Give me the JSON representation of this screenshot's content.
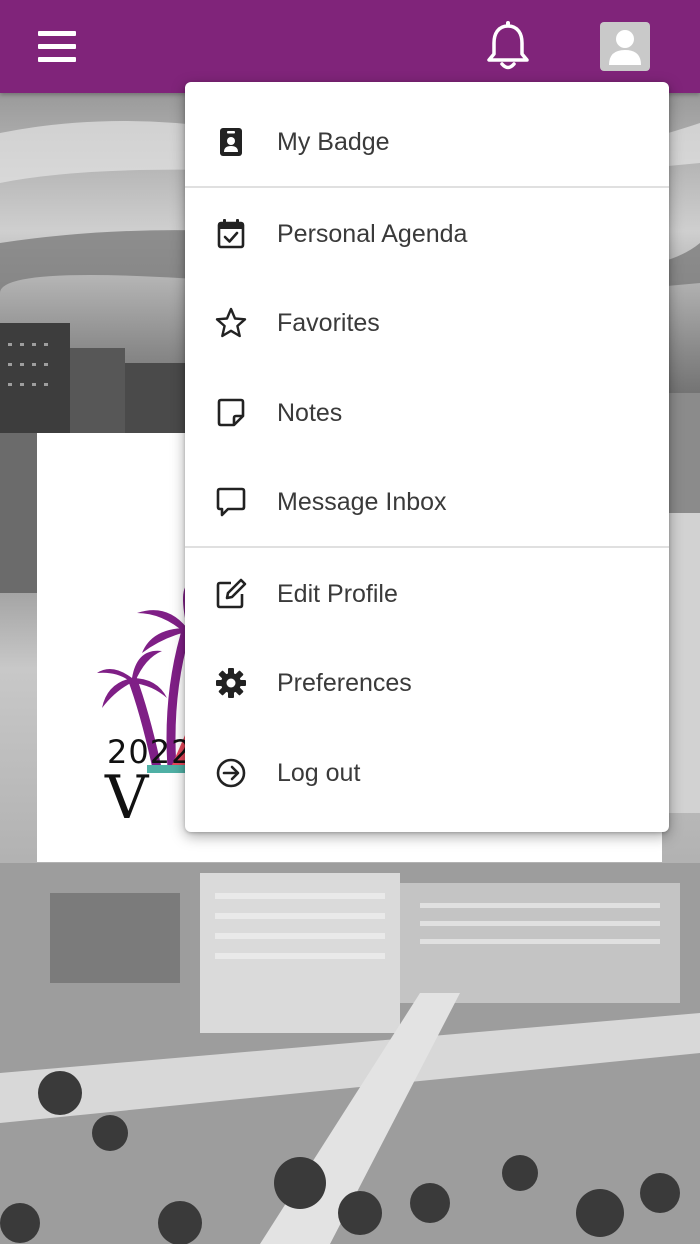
{
  "header": {
    "menu_icon": "hamburger-menu-icon",
    "notification_icon": "bell-icon",
    "avatar_icon": "user-avatar-icon",
    "background_color": "#80247a"
  },
  "event_logo": {
    "year": "2022",
    "roman_numeral": "V",
    "palm_color": "#7f1f86",
    "triangle_color": "#e8485b"
  },
  "user_menu": {
    "items": [
      {
        "label": "My Badge",
        "icon": "badge-icon"
      },
      {
        "label": "Personal Agenda",
        "icon": "calendar-check-icon"
      },
      {
        "label": "Favorites",
        "icon": "star-icon"
      },
      {
        "label": "Notes",
        "icon": "note-icon"
      },
      {
        "label": "Message Inbox",
        "icon": "chat-bubble-icon"
      },
      {
        "label": "Edit Profile",
        "icon": "edit-icon"
      },
      {
        "label": "Preferences",
        "icon": "gear-icon"
      },
      {
        "label": "Log out",
        "icon": "logout-icon"
      }
    ]
  }
}
